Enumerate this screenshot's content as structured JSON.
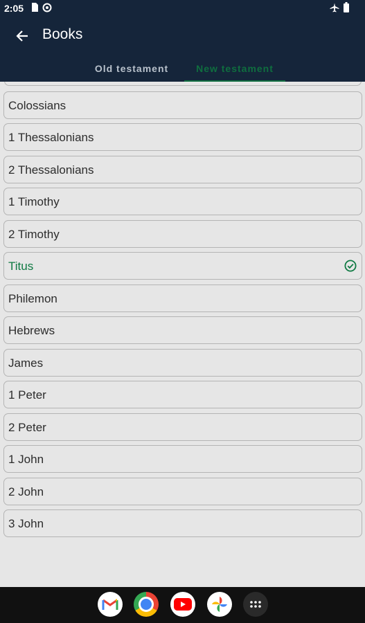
{
  "status_bar": {
    "time": "2:05"
  },
  "app_bar": {
    "title": "Books"
  },
  "tabs": [
    {
      "label": "Old testament",
      "selected": false
    },
    {
      "label": "New testament",
      "selected": true
    }
  ],
  "books": [
    {
      "label": "Colossians"
    },
    {
      "label": "1 Thessalonians"
    },
    {
      "label": "2 Thessalonians"
    },
    {
      "label": "1 Timothy"
    },
    {
      "label": "2 Timothy"
    },
    {
      "label": "Titus",
      "selected": true
    },
    {
      "label": "Philemon"
    },
    {
      "label": "Hebrews"
    },
    {
      "label": "James"
    },
    {
      "label": "1 Peter"
    },
    {
      "label": "2 Peter"
    },
    {
      "label": "1 John"
    },
    {
      "label": "2 John"
    },
    {
      "label": "3 John"
    }
  ],
  "dock": [
    "gmail-icon",
    "chrome-icon",
    "youtube-icon",
    "photos-icon",
    "app-drawer-icon"
  ],
  "colors": {
    "app_bar": "#15253a",
    "accent": "#0f6e3f",
    "background": "#e6e6e6"
  }
}
